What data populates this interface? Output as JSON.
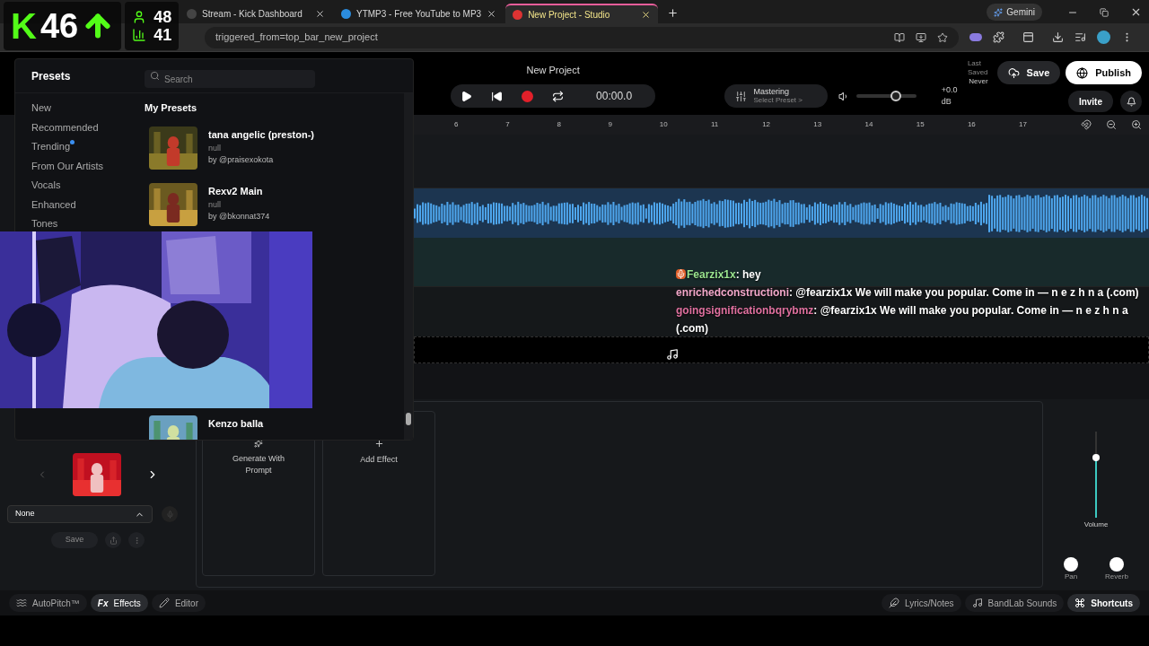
{
  "stream_stats": {
    "logo": "K",
    "viewers": "46",
    "followers": "48",
    "subs": "41"
  },
  "browser": {
    "tabs": [
      {
        "title": "Stream - Kick Dashboard",
        "selected": false
      },
      {
        "title": "YTMP3 - Free YouTube to MP3",
        "selected": false
      },
      {
        "title": "New Project - Studio",
        "selected": true
      }
    ],
    "gemini": "Gemini",
    "address": "triggered_from=top_bar_new_project"
  },
  "header": {
    "title": "New Project",
    "time": "00:00.0",
    "mastering": {
      "title": "Mastering",
      "subtitle": "Select Preset >"
    },
    "volume": {
      "level": 0.66,
      "reading": "+0.0 dB"
    },
    "last_saved_label": "Last Saved",
    "last_saved_value": "Never",
    "save": "Save",
    "publish": "Publish",
    "invite": "Invite"
  },
  "ruler": [
    "6",
    "7",
    "8",
    "9",
    "10",
    "11",
    "12",
    "13",
    "14",
    "15",
    "16",
    "17"
  ],
  "presets": {
    "title": "Presets",
    "search_placeholder": "Search",
    "categories": [
      {
        "label": "New",
        "dot": false
      },
      {
        "label": "Recommended",
        "dot": false
      },
      {
        "label": "Trending",
        "dot": true
      },
      {
        "label": "From Our Artists",
        "dot": false
      },
      {
        "label": "Vocals",
        "dot": false
      },
      {
        "label": "Enhanced",
        "dot": false
      },
      {
        "label": "Tones",
        "dot": false
      }
    ],
    "section": "My Presets",
    "items": [
      {
        "name": "tana angelic (preston-)",
        "description": "null",
        "author": "by @praisexokota"
      },
      {
        "name": "Rexv2 Main",
        "description": "null",
        "author": "by @bkonnat374"
      },
      {
        "name": "Kenzo balla"
      }
    ]
  },
  "chat": [
    {
      "user": "Fearzix1x",
      "color": "#9be58f",
      "badge": true,
      "text": ": hey"
    },
    {
      "user": "enrichedconstructioni",
      "color": "#f2a7c9",
      "badge": false,
      "text": ": @fearzix1x We will make you popular. Come in — n e z h n a (.com)"
    },
    {
      "user": "goingsignificationbqrybmz",
      "color": "#e0709f",
      "badge": false,
      "text": ": @fearzix1x We will make you popular. Come in — n e z h n a (.com)"
    }
  ],
  "instrument": {
    "select": "None",
    "save": "Save"
  },
  "effects": [
    {
      "kind": "generate",
      "label": "Generate With Prompt"
    },
    {
      "kind": "add",
      "label": "Add Effect"
    }
  ],
  "mixer": {
    "volume": {
      "level": 0.7,
      "label": "Volume"
    },
    "pan_label": "Pan",
    "reverb_label": "Reverb"
  },
  "bottom_tabs": [
    {
      "label": "AutoPitch™",
      "selected": false
    },
    {
      "label": "Effects",
      "icon_text": "Fx",
      "selected": true
    },
    {
      "label": "Editor",
      "selected": false
    }
  ],
  "bottom_right": [
    {
      "label": "Lyrics/Notes",
      "selected": false
    },
    {
      "label": "BandLab Sounds",
      "selected": false
    },
    {
      "label": "Shortcuts",
      "selected": true
    }
  ]
}
